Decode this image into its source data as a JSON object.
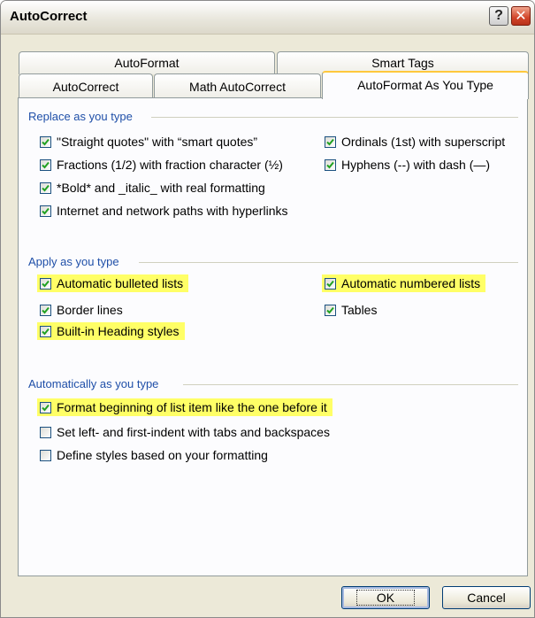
{
  "window": {
    "title": "AutoCorrect"
  },
  "titlebar": {
    "help_glyph": "?",
    "close_glyph": "✕"
  },
  "tabs": {
    "top_row": [
      {
        "label": "AutoFormat"
      },
      {
        "label": "Smart Tags"
      }
    ],
    "bottom_row": [
      {
        "label": "AutoCorrect"
      },
      {
        "label": "Math AutoCorrect"
      },
      {
        "label": "AutoFormat As You Type",
        "selected": true
      }
    ]
  },
  "groups": {
    "replace": {
      "label": "Replace as you type",
      "items": [
        {
          "label": "\"Straight quotes\" with “smart quotes”",
          "checked": true
        },
        {
          "label": "Fractions (1/2) with fraction character (½)",
          "checked": true
        },
        {
          "label": "*Bold* and _italic_ with real formatting",
          "checked": true
        },
        {
          "label": "Internet and network paths with hyperlinks",
          "checked": true
        },
        {
          "label": "Ordinals (1st) with superscript",
          "checked": true
        },
        {
          "label": "Hyphens (--) with dash (—)",
          "checked": true
        }
      ]
    },
    "apply": {
      "label": "Apply as you type",
      "items": [
        {
          "label": "Automatic bulleted lists",
          "checked": true,
          "highlighted": true
        },
        {
          "label": "Border lines",
          "checked": true,
          "highlighted": false
        },
        {
          "label": "Built-in Heading styles",
          "checked": true,
          "highlighted": true
        },
        {
          "label": "Automatic numbered lists",
          "checked": true,
          "highlighted": true
        },
        {
          "label": "Tables",
          "checked": true,
          "highlighted": false
        }
      ]
    },
    "auto": {
      "label": "Automatically as you type",
      "items": [
        {
          "label": "Format beginning of list item like the one before it",
          "checked": true,
          "highlighted": true
        },
        {
          "label": "Set left- and first-indent with tabs and backspaces",
          "checked": false,
          "highlighted": false
        },
        {
          "label": "Define styles based on your formatting",
          "checked": false,
          "highlighted": false
        }
      ]
    }
  },
  "buttons": {
    "ok": "OK",
    "cancel": "Cancel"
  },
  "colors": {
    "highlight": "#ffff66",
    "group_label": "#1f4fa8",
    "active_tab_accent": "#ffc83c"
  }
}
